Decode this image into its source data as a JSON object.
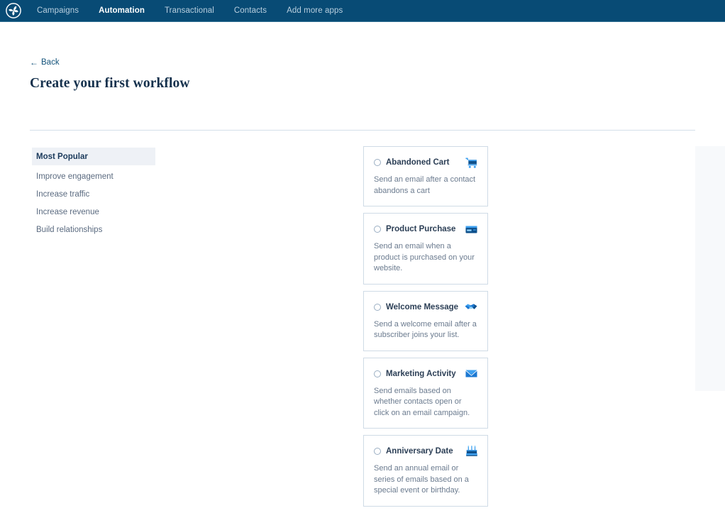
{
  "nav": {
    "logo_icon": "pinwheel-logo-icon",
    "brand_color": "#084b75",
    "items": [
      {
        "label": "Campaigns",
        "active": false
      },
      {
        "label": "Automation",
        "active": true
      },
      {
        "label": "Transactional",
        "active": false
      },
      {
        "label": "Contacts",
        "active": false
      },
      {
        "label": "Add more apps",
        "active": false
      }
    ]
  },
  "header": {
    "back_label": "Back",
    "back_icon": "arrow-left-icon",
    "title": "Create your first workflow"
  },
  "sidebar": {
    "items": [
      {
        "label": "Most Popular",
        "selected": true
      },
      {
        "label": "Improve engagement",
        "selected": false
      },
      {
        "label": "Increase traffic",
        "selected": false
      },
      {
        "label": "Increase revenue",
        "selected": false
      },
      {
        "label": "Build relationships",
        "selected": false
      }
    ]
  },
  "workflows": {
    "accent_color": "#1b77d1",
    "cards": [
      {
        "title": "Abandoned Cart",
        "description": "Send an email after a contact abandons a cart",
        "icon": "shopping-cart-icon",
        "selected": false
      },
      {
        "title": "Product Purchase",
        "description": "Send an email when a product is purchased on your website.",
        "icon": "credit-card-icon",
        "selected": false
      },
      {
        "title": "Welcome Message",
        "description": "Send a welcome email after a subscriber joins your list.",
        "icon": "handshake-icon",
        "selected": false
      },
      {
        "title": "Marketing Activity",
        "description": "Send emails based on whether contacts open or click on an email campaign.",
        "icon": "envelope-icon",
        "selected": false
      },
      {
        "title": "Anniversary Date",
        "description": "Send an annual email or series of emails based on a special event or birthday.",
        "icon": "birthday-cake-icon",
        "selected": false
      }
    ]
  }
}
